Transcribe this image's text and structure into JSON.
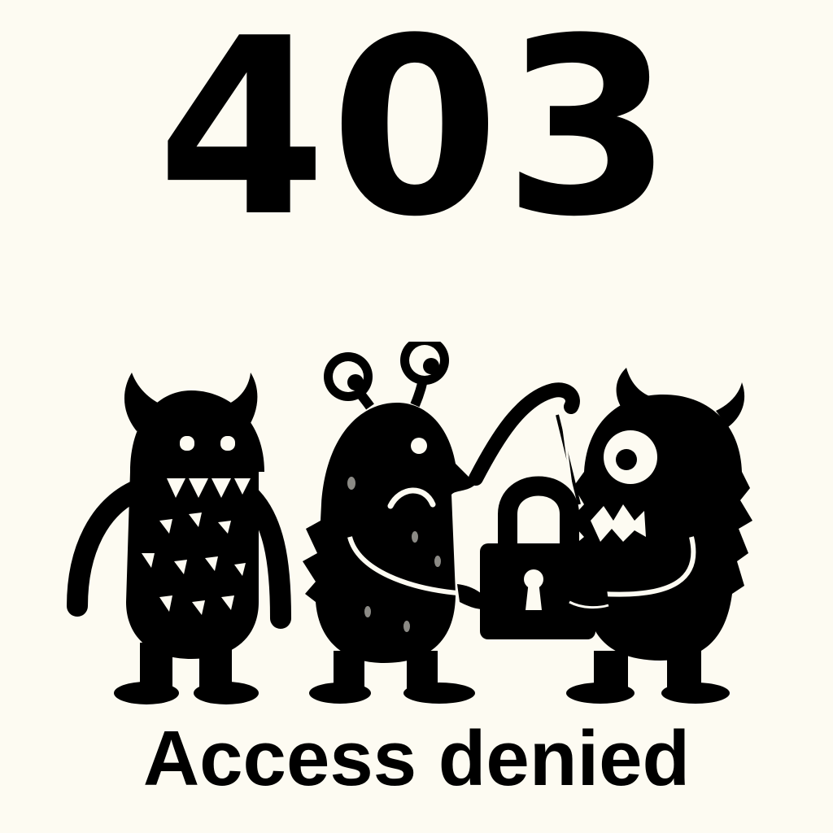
{
  "error": {
    "code": "403",
    "message": "Access denied"
  },
  "illustration": {
    "icons": [
      "horned-monster-icon",
      "sad-eyestalk-monster-icon",
      "one-eyed-monster-icon",
      "padlock-icon"
    ],
    "ink_color": "#000000",
    "background_color": "#fdfbf2"
  }
}
